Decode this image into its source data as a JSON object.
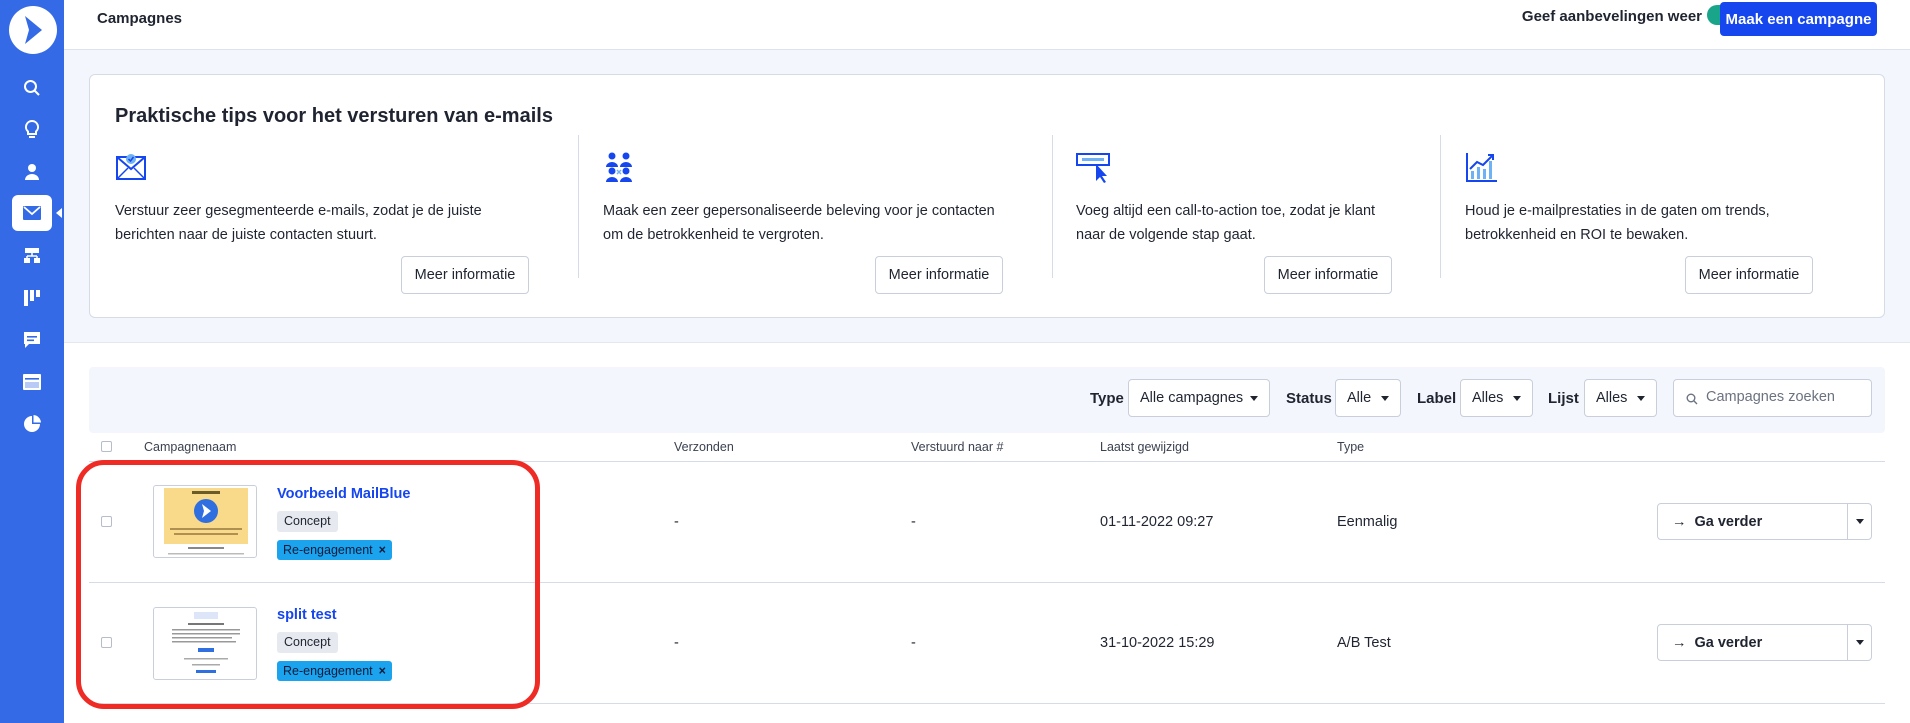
{
  "header": {
    "title": "Campagnes",
    "recommendations_label": "Geef aanbevelingen weer",
    "recommendations_on": true,
    "create_button": "Maak een campagne"
  },
  "sidebar": {
    "icons": [
      "logo-icon",
      "search-icon",
      "lightbulb-icon",
      "contacts-icon",
      "email-icon",
      "automations-icon",
      "pipeline-icon",
      "conversations-icon",
      "site-icon",
      "reports-icon"
    ],
    "active": "email-icon"
  },
  "tips": {
    "title": "Praktische tips voor het versturen van e-mails",
    "items": [
      {
        "text_line1": "Verstuur zeer gesegmenteerde e-mails, zodat je de juiste",
        "text_line2": "berichten naar de juiste contacten stuurt.",
        "button": "Meer informatie"
      },
      {
        "text_line1": "Maak een zeer gepersonaliseerde beleving voor je contacten",
        "text_line2": "om de betrokkenheid te vergroten.",
        "button": "Meer informatie"
      },
      {
        "text_line1": "Voeg altijd een call-to-action toe, zodat je klant",
        "text_line2": "naar de volgende stap gaat.",
        "button": "Meer informatie"
      },
      {
        "text_line1": "Houd je e-mailprestaties in de gaten om trends,",
        "text_line2": "betrokkenheid en ROI te bewaken.",
        "button": "Meer informatie"
      }
    ]
  },
  "filters": {
    "type_label": "Type",
    "type_value": "Alle campagnes",
    "status_label": "Status",
    "status_value": "Alle",
    "label_label": "Label",
    "label_value": "Alles",
    "list_label": "Lijst",
    "list_value": "Alles",
    "search_placeholder": "Campagnes zoeken"
  },
  "table": {
    "columns": [
      "Campagnenaam",
      "Verzonden",
      "Verstuurd naar #",
      "Laatst gewijzigd",
      "Type"
    ],
    "rows": [
      {
        "name": "Voorbeeld MailBlue",
        "status": "Concept",
        "tag": "Re-engagement",
        "sent": "-",
        "sent_to": "-",
        "modified": "01-11-2022 09:27",
        "type": "Eenmalig",
        "action": "Ga verder"
      },
      {
        "name": "split test",
        "status": "Concept",
        "tag": "Re-engagement",
        "sent": "-",
        "sent_to": "-",
        "modified": "31-10-2022 15:29",
        "type": "A/B Test",
        "action": "Ga verder"
      }
    ]
  },
  "colors": {
    "sidebar": "#356ae6",
    "primary": "#1646ee",
    "toggle": "#19a589",
    "tag": "#1ba3ee",
    "annotation": "#ee2b25"
  }
}
